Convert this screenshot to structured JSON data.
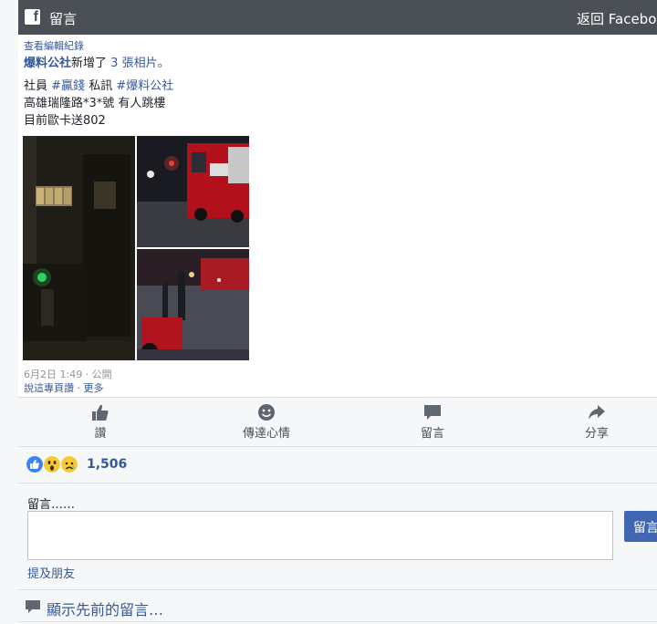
{
  "header": {
    "title": "留言",
    "back_label": "返回 Facebook",
    "logo_letter": "f"
  },
  "post": {
    "edit_history_link": "查看編輯紀錄",
    "page_name": "爆料公社",
    "story_prefix": "新增了",
    "photo_count": "3",
    "story_suffix": "張相片。",
    "line1_prefix": "社員",
    "tag1": "#贏錢",
    "line1_mid": "私訊",
    "tag2": "#爆料公社",
    "line2": "高雄瑞隆路*3*號 有人跳樓",
    "line3": "目前歐卡送802",
    "timestamp": "6月2日 1:49 · 公開",
    "links": "說這專頁讚 · 更多"
  },
  "actions": [
    {
      "label": "讚",
      "icon": "thumbs-up-icon"
    },
    {
      "label": "傳達心情",
      "icon": "smiley-icon"
    },
    {
      "label": "留言",
      "icon": "comment-bubble-icon"
    },
    {
      "label": "分享",
      "icon": "share-arrow-icon"
    }
  ],
  "reactions": {
    "count": "1,506",
    "types": [
      "like",
      "wow",
      "sad"
    ]
  },
  "comment_form": {
    "label": "留言……",
    "submit_label": "留言",
    "mention_link": "提及朋友"
  },
  "previous_comments": {
    "label": "顯示先前的留言…"
  },
  "colors": {
    "header_bg": "#4b4f56",
    "link": "#365899",
    "button": "#4267b2"
  }
}
